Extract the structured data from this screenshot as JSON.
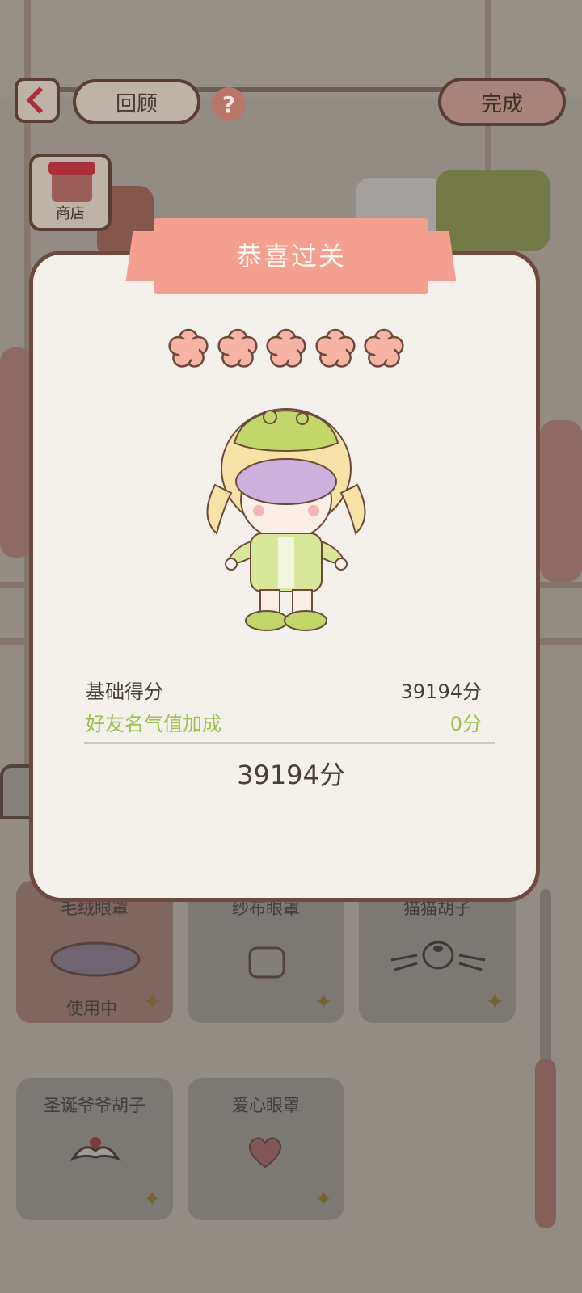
{
  "top_bar": {
    "review_label": "回顾",
    "help_glyph": "?",
    "done_label": "完成"
  },
  "shop": {
    "label": "商店"
  },
  "modal": {
    "title": "恭喜过关",
    "stars_filled": 5,
    "base_score_label": "基础得分",
    "base_score_value": "39194分",
    "bonus_label": "好友名气值加成",
    "bonus_value": "0分",
    "total_score": "39194分"
  },
  "items": [
    {
      "name": "毛绒眼罩",
      "status": "使用中",
      "icon": "fluffy-eye-mask-icon"
    },
    {
      "name": "纱布眼罩",
      "status": "",
      "icon": "gauze-eye-patch-icon"
    },
    {
      "name": "猫猫胡子",
      "status": "",
      "icon": "cat-whiskers-icon"
    },
    {
      "name": "圣诞爷爷胡子",
      "status": "",
      "icon": "santa-beard-icon"
    },
    {
      "name": "爱心眼罩",
      "status": "",
      "icon": "heart-eye-mask-icon"
    }
  ],
  "colors": {
    "accent_pink": "#f59f90",
    "bonus_green": "#9cc04a",
    "frame_brown": "#6d4a40"
  }
}
